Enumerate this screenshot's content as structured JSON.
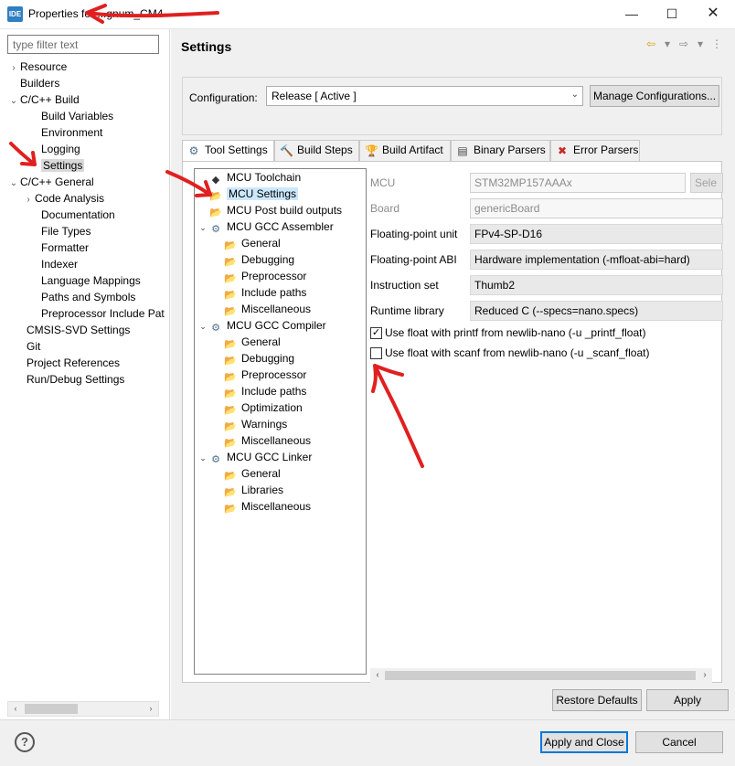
{
  "window": {
    "app_icon_text": "IDE",
    "title": "Properties for ...gnum_CM4",
    "minimize": "—",
    "maximize": "☐",
    "close": "✕"
  },
  "left": {
    "filter_placeholder": "type filter text",
    "items": [
      {
        "label": "Resource",
        "twisty": "›"
      },
      {
        "label": "Builders",
        "twisty": ""
      },
      {
        "label": "C/C++ Build",
        "twisty": "⌄"
      },
      {
        "label": "Build Variables",
        "twisty": ""
      },
      {
        "label": "Environment",
        "twisty": ""
      },
      {
        "label": "Logging",
        "twisty": ""
      },
      {
        "label": "Settings",
        "twisty": ""
      },
      {
        "label": "C/C++ General",
        "twisty": "⌄"
      },
      {
        "label": "Code Analysis",
        "twisty": "›"
      },
      {
        "label": "Documentation",
        "twisty": ""
      },
      {
        "label": "File Types",
        "twisty": ""
      },
      {
        "label": "Formatter",
        "twisty": ""
      },
      {
        "label": "Indexer",
        "twisty": ""
      },
      {
        "label": "Language Mappings",
        "twisty": ""
      },
      {
        "label": "Paths and Symbols",
        "twisty": ""
      },
      {
        "label": "Preprocessor Include Pat",
        "twisty": ""
      },
      {
        "label": "CMSIS-SVD Settings",
        "twisty": ""
      },
      {
        "label": "Git",
        "twisty": ""
      },
      {
        "label": "Project References",
        "twisty": ""
      },
      {
        "label": "Run/Debug Settings",
        "twisty": ""
      }
    ],
    "scroll_left": "‹",
    "scroll_right": "›"
  },
  "header": {
    "title": "Settings",
    "back_icon": "⇦",
    "dropdown_icon": "▾",
    "forward_icon": "⇨",
    "menu_icon": "⋮"
  },
  "config": {
    "label": "Configuration:",
    "value": "Release  [ Active ]",
    "chevron": "⌄",
    "manage_label": "Manage Configurations..."
  },
  "tabs": [
    {
      "label": "Tool Settings",
      "icon": "⚙"
    },
    {
      "label": "Build Steps",
      "icon": "🔨"
    },
    {
      "label": "Build Artifact",
      "icon": "🏆"
    },
    {
      "label": "Binary Parsers",
      "icon": "▤"
    },
    {
      "label": "Error Parsers",
      "icon": "✖"
    }
  ],
  "tool_tree": [
    {
      "label": "MCU Toolchain",
      "icon": "◆",
      "twisty": ""
    },
    {
      "label": "MCU Settings",
      "icon": "📂",
      "twisty": ""
    },
    {
      "label": "MCU Post build outputs",
      "icon": "📂",
      "twisty": ""
    },
    {
      "label": "MCU GCC Assembler",
      "icon": "⚙",
      "twisty": "⌄"
    },
    {
      "label": "General",
      "icon": "📂",
      "twisty": ""
    },
    {
      "label": "Debugging",
      "icon": "📂",
      "twisty": ""
    },
    {
      "label": "Preprocessor",
      "icon": "📂",
      "twisty": ""
    },
    {
      "label": "Include paths",
      "icon": "📂",
      "twisty": ""
    },
    {
      "label": "Miscellaneous",
      "icon": "📂",
      "twisty": ""
    },
    {
      "label": "MCU GCC Compiler",
      "icon": "⚙",
      "twisty": "⌄"
    },
    {
      "label": "General",
      "icon": "📂",
      "twisty": ""
    },
    {
      "label": "Debugging",
      "icon": "📂",
      "twisty": ""
    },
    {
      "label": "Preprocessor",
      "icon": "📂",
      "twisty": ""
    },
    {
      "label": "Include paths",
      "icon": "📂",
      "twisty": ""
    },
    {
      "label": "Optimization",
      "icon": "📂",
      "twisty": ""
    },
    {
      "label": "Warnings",
      "icon": "📂",
      "twisty": ""
    },
    {
      "label": "Miscellaneous",
      "icon": "📂",
      "twisty": ""
    },
    {
      "label": "MCU GCC Linker",
      "icon": "⚙",
      "twisty": "⌄"
    },
    {
      "label": "General",
      "icon": "📂",
      "twisty": ""
    },
    {
      "label": "Libraries",
      "icon": "📂",
      "twisty": ""
    },
    {
      "label": "Miscellaneous",
      "icon": "📂",
      "twisty": ""
    }
  ],
  "form": {
    "mcu_label": "MCU",
    "mcu_value": "STM32MP157AAAx",
    "select_label": "Sele",
    "board_label": "Board",
    "board_value": "genericBoard",
    "fpu_label": "Floating-point unit",
    "fpu_value": "FPv4-SP-D16",
    "fpabi_label": "Floating-point ABI",
    "fpabi_value": "Hardware implementation (-mfloat-abi=hard)",
    "iset_label": "Instruction set",
    "iset_value": "Thumb2",
    "rtlib_label": "Runtime library",
    "rtlib_value": "Reduced C (--specs=nano.specs)",
    "printf_label": "Use float with printf from newlib-nano (-u _printf_float)",
    "printf_checked": "✓",
    "scanf_label": "Use float with scanf from newlib-nano (-u _scanf_float)",
    "scanf_checked": ""
  },
  "buttons": {
    "restore": "Restore Defaults",
    "apply": "Apply",
    "apply_close": "Apply and Close",
    "cancel": "Cancel",
    "help": "?"
  },
  "colors": {
    "annotation_red": "#e02020",
    "accent_blue": "#0078d7"
  }
}
